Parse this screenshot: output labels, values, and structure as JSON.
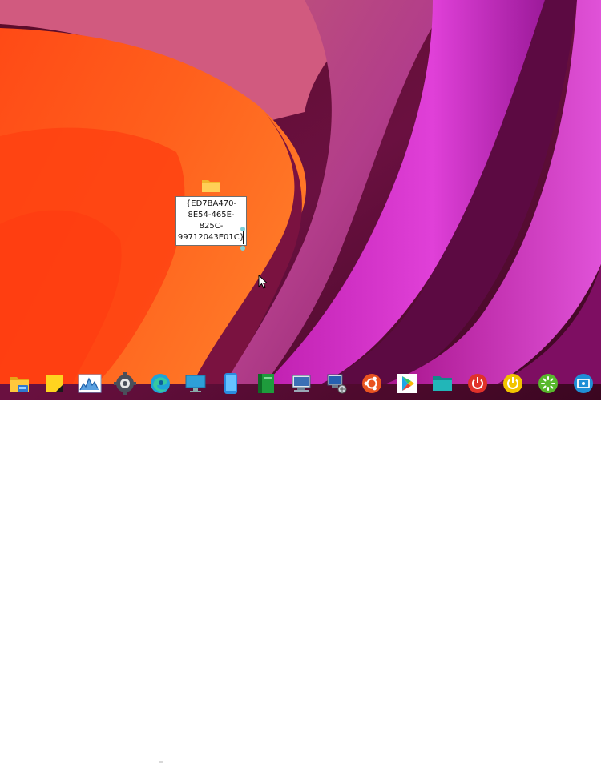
{
  "desktop": {
    "folder_icon": "folder-icon",
    "rename_text": "{ED7BA470-\n8E54-465E-\n825C-\n99712043E01C}"
  },
  "taskbar": {
    "apps": [
      {
        "name": "file-explorer",
        "icon": "folder-drive-icon"
      },
      {
        "name": "sticky-notes",
        "icon": "sticky-notes-icon"
      },
      {
        "name": "system-monitor",
        "icon": "chart-icon"
      },
      {
        "name": "settings",
        "icon": "gear-icon"
      },
      {
        "name": "edge-browser",
        "icon": "edge-icon",
        "running": true
      },
      {
        "name": "monitor",
        "icon": "monitor-icon"
      },
      {
        "name": "phone-link",
        "icon": "phone-icon"
      },
      {
        "name": "green-book",
        "icon": "book-icon"
      },
      {
        "name": "remote-desktop",
        "icon": "remote-desktop-icon"
      },
      {
        "name": "network-computer",
        "icon": "network-computer-icon"
      },
      {
        "name": "ubuntu",
        "icon": "ubuntu-icon"
      },
      {
        "name": "play-store",
        "icon": "play-store-icon"
      },
      {
        "name": "folder",
        "icon": "folder-teal-icon"
      },
      {
        "name": "shutdown",
        "icon": "power-red-icon"
      },
      {
        "name": "restart",
        "icon": "power-yellow-icon"
      },
      {
        "name": "loading",
        "icon": "spinner-green-icon"
      },
      {
        "name": "screen-tool",
        "icon": "screen-tool-icon"
      }
    ]
  }
}
